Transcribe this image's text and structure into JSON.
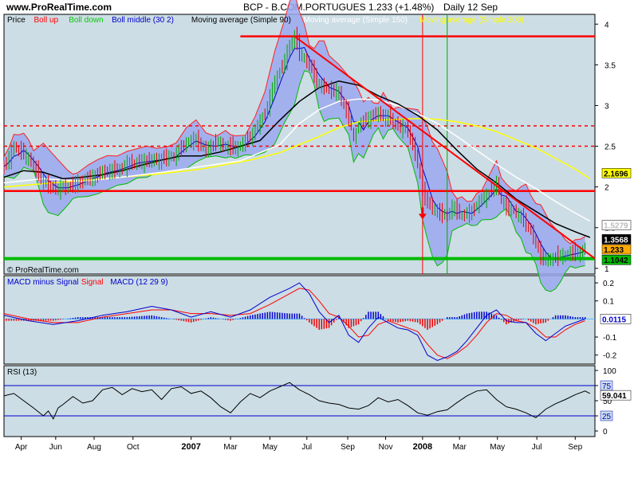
{
  "header": {
    "site": "www.ProRealTime.com",
    "instrument": "BCP - B.COM.PORTUGUES",
    "last_quote": "1.233 (+1.48%)",
    "period": "Daily 12 Sep"
  },
  "watermark": "© ProRealTime.com",
  "legends": {
    "price": [
      {
        "text": "Price",
        "color": "#000000"
      },
      {
        "text": "Boll up",
        "color": "#ff0000"
      },
      {
        "text": "Boll down",
        "color": "#00cc00"
      },
      {
        "text": "Boll middle (30 2)",
        "color": "#0000cc"
      },
      {
        "text": "Moving average (Simple 90)",
        "color": "#000000"
      },
      {
        "text": "Moving average (Simple 150)",
        "color": "#ffffff"
      },
      {
        "text": "Moving average (Simple 200)",
        "color": "#ffff00"
      }
    ],
    "macd": [
      {
        "text": "MACD minus Signal",
        "color": "#0000cc"
      },
      {
        "text": "Signal",
        "color": "#ff0000"
      },
      {
        "text": "MACD (12 29 9)",
        "color": "#0000cc"
      }
    ],
    "rsi": [
      {
        "text": "RSI (13)",
        "color": "#000000"
      }
    ]
  },
  "colors": {
    "panel_bg": "#ccdde5",
    "page_bg": "#ffffff",
    "band_fill": "#9aa8ee",
    "boll_up": "#ff2020",
    "boll_down": "#00bb00",
    "boll_mid": "#0000cc",
    "ma90": "#000000",
    "ma150": "#ffffff",
    "ma200": "#ffff00",
    "trend": "#ff0000",
    "support": "#00bb00",
    "resistance": "#ff0000",
    "candle_up": "#00aa00",
    "candle_down": "#ee0000"
  },
  "time_axis": {
    "labels": [
      "Apr",
      "Jun",
      "Aug",
      "Oct",
      "2007",
      "Mar",
      "May",
      "Jul",
      "Sep",
      "Nov",
      "2008",
      "Mar",
      "May",
      "Jul",
      "Sep"
    ],
    "bold_labels": [
      "2007",
      "2008"
    ]
  },
  "chart_data": [
    {
      "type": "line",
      "panel": "price",
      "ylim": [
        0.93,
        4.12
      ],
      "y_ticks": [
        1,
        1.5,
        2,
        2.5,
        3,
        3.5,
        4
      ],
      "y_tick_labels": [
        "1",
        "1.5",
        "2",
        "2.5",
        "3",
        "3.5",
        "4"
      ],
      "x_labels": [
        "Apr",
        "Jun",
        "Aug",
        "Oct",
        "2007",
        "Mar",
        "May",
        "Jul",
        "Sep",
        "Nov",
        "2008",
        "Mar",
        "May",
        "Jul",
        "Sep"
      ],
      "x_range": [
        0,
        120
      ],
      "grid": false,
      "legend_position": "top",
      "price_points": [
        [
          0,
          2.25
        ],
        [
          1,
          2.35
        ],
        [
          2,
          2.5
        ],
        [
          3,
          2.45
        ],
        [
          5,
          2.35
        ],
        [
          7,
          2.15
        ],
        [
          9,
          2.0
        ],
        [
          11,
          1.98
        ],
        [
          13,
          2.0
        ],
        [
          15,
          2.05
        ],
        [
          17,
          2.1
        ],
        [
          19,
          2.15
        ],
        [
          21,
          2.2
        ],
        [
          23,
          2.2
        ],
        [
          25,
          2.28
        ],
        [
          27,
          2.3
        ],
        [
          29,
          2.32
        ],
        [
          31,
          2.33
        ],
        [
          33,
          2.35
        ],
        [
          35,
          2.4
        ],
        [
          37,
          2.55
        ],
        [
          39,
          2.58
        ],
        [
          41,
          2.45
        ],
        [
          43,
          2.55
        ],
        [
          45,
          2.5
        ],
        [
          47,
          2.48
        ],
        [
          49,
          2.55
        ],
        [
          51,
          2.7
        ],
        [
          53,
          2.9
        ],
        [
          55,
          3.3
        ],
        [
          57,
          3.55
        ],
        [
          58,
          3.75
        ],
        [
          59,
          3.85
        ],
        [
          60,
          3.65
        ],
        [
          62,
          3.5
        ],
        [
          64,
          3.25
        ],
        [
          66,
          3.2
        ],
        [
          68,
          3.15
        ],
        [
          70,
          2.85
        ],
        [
          71,
          2.6
        ],
        [
          72,
          2.75
        ],
        [
          74,
          2.85
        ],
        [
          76,
          2.9
        ],
        [
          78,
          2.85
        ],
        [
          80,
          2.75
        ],
        [
          82,
          2.7
        ],
        [
          83,
          2.5
        ],
        [
          84,
          2.3
        ],
        [
          85,
          1.95
        ],
        [
          86,
          1.8
        ],
        [
          87,
          1.75
        ],
        [
          88,
          1.7
        ],
        [
          89,
          1.65
        ],
        [
          90,
          1.65
        ],
        [
          91,
          1.75
        ],
        [
          92,
          1.7
        ],
        [
          93,
          1.65
        ],
        [
          95,
          1.7
        ],
        [
          97,
          1.85
        ],
        [
          99,
          1.95
        ],
        [
          100,
          2.05
        ],
        [
          101,
          1.85
        ],
        [
          102,
          1.72
        ],
        [
          103,
          1.75
        ],
        [
          104,
          1.68
        ],
        [
          105,
          1.62
        ],
        [
          106,
          1.55
        ],
        [
          107,
          1.45
        ],
        [
          108,
          1.3
        ],
        [
          109,
          1.15
        ],
        [
          110,
          1.1
        ],
        [
          111,
          1.12
        ],
        [
          113,
          1.15
        ],
        [
          115,
          1.18
        ],
        [
          117,
          1.2
        ],
        [
          118,
          1.233
        ]
      ],
      "moving_average_90": [
        [
          0,
          2.12
        ],
        [
          4,
          2.2
        ],
        [
          8,
          2.18
        ],
        [
          12,
          2.1
        ],
        [
          16,
          2.12
        ],
        [
          20,
          2.15
        ],
        [
          24,
          2.2
        ],
        [
          28,
          2.27
        ],
        [
          32,
          2.33
        ],
        [
          36,
          2.38
        ],
        [
          40,
          2.38
        ],
        [
          44,
          2.43
        ],
        [
          48,
          2.5
        ],
        [
          52,
          2.57
        ],
        [
          56,
          2.82
        ],
        [
          60,
          3.05
        ],
        [
          64,
          3.22
        ],
        [
          68,
          3.3
        ],
        [
          72,
          3.25
        ],
        [
          76,
          3.12
        ],
        [
          80,
          3.02
        ],
        [
          84,
          2.88
        ],
        [
          88,
          2.7
        ],
        [
          92,
          2.45
        ],
        [
          96,
          2.22
        ],
        [
          100,
          2.05
        ],
        [
          104,
          1.85
        ],
        [
          108,
          1.7
        ],
        [
          112,
          1.55
        ],
        [
          116,
          1.45
        ],
        [
          119,
          1.38
        ]
      ],
      "moving_average_150": [
        [
          0,
          2.05
        ],
        [
          8,
          2.1
        ],
        [
          16,
          2.07
        ],
        [
          24,
          2.12
        ],
        [
          32,
          2.18
        ],
        [
          40,
          2.25
        ],
        [
          48,
          2.32
        ],
        [
          56,
          2.52
        ],
        [
          60,
          2.78
        ],
        [
          64,
          2.95
        ],
        [
          68,
          3.05
        ],
        [
          72,
          3.08
        ],
        [
          76,
          3.07
        ],
        [
          80,
          3.0
        ],
        [
          84,
          2.9
        ],
        [
          88,
          2.78
        ],
        [
          92,
          2.62
        ],
        [
          96,
          2.45
        ],
        [
          100,
          2.28
        ],
        [
          104,
          2.12
        ],
        [
          108,
          1.98
        ],
        [
          112,
          1.82
        ],
        [
          116,
          1.68
        ],
        [
          119,
          1.58
        ]
      ],
      "moving_average_200": [
        [
          0,
          2.0
        ],
        [
          10,
          2.05
        ],
        [
          20,
          2.1
        ],
        [
          30,
          2.15
        ],
        [
          40,
          2.22
        ],
        [
          50,
          2.33
        ],
        [
          56,
          2.42
        ],
        [
          60,
          2.52
        ],
        [
          64,
          2.62
        ],
        [
          68,
          2.73
        ],
        [
          72,
          2.8
        ],
        [
          76,
          2.82
        ],
        [
          80,
          2.83
        ],
        [
          84,
          2.84
        ],
        [
          88,
          2.83
        ],
        [
          92,
          2.8
        ],
        [
          96,
          2.75
        ],
        [
          100,
          2.68
        ],
        [
          104,
          2.58
        ],
        [
          108,
          2.48
        ],
        [
          112,
          2.35
        ],
        [
          116,
          2.22
        ],
        [
          119,
          2.1
        ]
      ],
      "horizontal_lines": [
        {
          "value": 3.85,
          "style": "solid",
          "color": "#ff0000"
        },
        {
          "value": 2.75,
          "style": "dashed",
          "color": "#ff0000"
        },
        {
          "value": 2.5,
          "style": "dashed",
          "color": "#ff0000"
        },
        {
          "value": 1.95,
          "style": "solid",
          "color": "#ff0000"
        },
        {
          "value": 1.12,
          "style": "solid",
          "color": "#00bb00"
        }
      ],
      "trendline": {
        "from": [
          59,
          3.85
        ],
        "to": [
          120,
          1.12
        ]
      },
      "value_labels": [
        {
          "text": "2.1696",
          "bg": "#ffff00",
          "value": 2.17
        },
        {
          "text": "1.5279",
          "bg": "#ffffff",
          "value": 1.53
        },
        {
          "text": "1.3568",
          "bg": "#000000",
          "value": 1.357
        },
        {
          "text": "1.233",
          "bg": "#ffaa00",
          "value": 1.233
        },
        {
          "text": "1.1042",
          "bg": "#00bb00",
          "value": 1.104
        }
      ]
    },
    {
      "type": "bar",
      "panel": "macd",
      "ylim": [
        -0.25,
        0.24
      ],
      "y_ticks": [
        0.2,
        0.1,
        -0.1,
        -0.2
      ],
      "y_tick_labels": [
        "0.2",
        "0.1",
        "-0.1",
        "-0.2"
      ],
      "macd_series": [
        [
          0,
          0.02
        ],
        [
          5,
          -0.01
        ],
        [
          10,
          -0.03
        ],
        [
          15,
          -0.01
        ],
        [
          20,
          0.02
        ],
        [
          25,
          0.04
        ],
        [
          30,
          0.07
        ],
        [
          34,
          0.05
        ],
        [
          38,
          0.01
        ],
        [
          42,
          0.04
        ],
        [
          46,
          0.01
        ],
        [
          50,
          0.05
        ],
        [
          54,
          0.12
        ],
        [
          58,
          0.17
        ],
        [
          60,
          0.2
        ],
        [
          62,
          0.14
        ],
        [
          64,
          0.04
        ],
        [
          66,
          -0.02
        ],
        [
          68,
          0.02
        ],
        [
          70,
          -0.09
        ],
        [
          72,
          -0.13
        ],
        [
          74,
          -0.05
        ],
        [
          76,
          0.01
        ],
        [
          78,
          -0.02
        ],
        [
          80,
          -0.05
        ],
        [
          82,
          -0.06
        ],
        [
          84,
          -0.09
        ],
        [
          86,
          -0.2
        ],
        [
          88,
          -0.23
        ],
        [
          90,
          -0.21
        ],
        [
          92,
          -0.18
        ],
        [
          94,
          -0.12
        ],
        [
          96,
          -0.05
        ],
        [
          98,
          0.02
        ],
        [
          100,
          0.05
        ],
        [
          102,
          -0.01
        ],
        [
          104,
          -0.02
        ],
        [
          106,
          -0.02
        ],
        [
          108,
          -0.08
        ],
        [
          110,
          -0.12
        ],
        [
          112,
          -0.08
        ],
        [
          114,
          -0.04
        ],
        [
          116,
          -0.02
        ],
        [
          118,
          0.0
        ]
      ],
      "signal_series": [
        [
          0,
          0.03
        ],
        [
          5,
          0.0
        ],
        [
          10,
          -0.02
        ],
        [
          15,
          -0.02
        ],
        [
          20,
          0.01
        ],
        [
          25,
          0.03
        ],
        [
          30,
          0.05
        ],
        [
          34,
          0.05
        ],
        [
          38,
          0.03
        ],
        [
          42,
          0.03
        ],
        [
          46,
          0.02
        ],
        [
          50,
          0.03
        ],
        [
          54,
          0.08
        ],
        [
          58,
          0.14
        ],
        [
          60,
          0.17
        ],
        [
          62,
          0.16
        ],
        [
          64,
          0.1
        ],
        [
          66,
          0.03
        ],
        [
          68,
          0.01
        ],
        [
          70,
          -0.04
        ],
        [
          72,
          -0.1
        ],
        [
          74,
          -0.09
        ],
        [
          76,
          -0.03
        ],
        [
          78,
          -0.01
        ],
        [
          80,
          -0.03
        ],
        [
          82,
          -0.05
        ],
        [
          84,
          -0.07
        ],
        [
          86,
          -0.14
        ],
        [
          88,
          -0.2
        ],
        [
          90,
          -0.22
        ],
        [
          92,
          -0.19
        ],
        [
          94,
          -0.15
        ],
        [
          96,
          -0.09
        ],
        [
          98,
          -0.02
        ],
        [
          100,
          0.03
        ],
        [
          102,
          0.02
        ],
        [
          104,
          -0.01
        ],
        [
          106,
          -0.02
        ],
        [
          108,
          -0.05
        ],
        [
          110,
          -0.1
        ],
        [
          112,
          -0.1
        ],
        [
          114,
          -0.06
        ],
        [
          116,
          -0.03
        ],
        [
          118,
          -0.01
        ]
      ],
      "current_value": "0.0115"
    },
    {
      "type": "line",
      "panel": "rsi",
      "ylim": [
        0,
        100
      ],
      "y_ticks": [
        100,
        75,
        50,
        25,
        0
      ],
      "y_tick_labels": [
        "100",
        "75",
        "50",
        "25",
        "0"
      ],
      "levels": [
        75,
        25
      ],
      "level_labels": [
        "75",
        "25"
      ],
      "rsi_series": [
        [
          0,
          58
        ],
        [
          2,
          62
        ],
        [
          4,
          50
        ],
        [
          6,
          38
        ],
        [
          8,
          25
        ],
        [
          9,
          33
        ],
        [
          10,
          20
        ],
        [
          11,
          38
        ],
        [
          12,
          44
        ],
        [
          14,
          57
        ],
        [
          16,
          46
        ],
        [
          18,
          50
        ],
        [
          20,
          68
        ],
        [
          22,
          72
        ],
        [
          24,
          60
        ],
        [
          26,
          70
        ],
        [
          28,
          65
        ],
        [
          30,
          68
        ],
        [
          32,
          52
        ],
        [
          34,
          70
        ],
        [
          36,
          73
        ],
        [
          38,
          62
        ],
        [
          40,
          66
        ],
        [
          42,
          55
        ],
        [
          44,
          40
        ],
        [
          46,
          30
        ],
        [
          48,
          48
        ],
        [
          50,
          62
        ],
        [
          52,
          55
        ],
        [
          54,
          66
        ],
        [
          56,
          73
        ],
        [
          58,
          80
        ],
        [
          60,
          68
        ],
        [
          62,
          60
        ],
        [
          64,
          50
        ],
        [
          66,
          46
        ],
        [
          68,
          44
        ],
        [
          70,
          38
        ],
        [
          72,
          36
        ],
        [
          74,
          42
        ],
        [
          76,
          55
        ],
        [
          78,
          48
        ],
        [
          80,
          52
        ],
        [
          82,
          42
        ],
        [
          84,
          30
        ],
        [
          86,
          26
        ],
        [
          88,
          32
        ],
        [
          90,
          35
        ],
        [
          92,
          47
        ],
        [
          94,
          58
        ],
        [
          96,
          66
        ],
        [
          98,
          68
        ],
        [
          100,
          52
        ],
        [
          102,
          40
        ],
        [
          104,
          36
        ],
        [
          106,
          30
        ],
        [
          108,
          22
        ],
        [
          110,
          36
        ],
        [
          112,
          45
        ],
        [
          114,
          52
        ],
        [
          116,
          60
        ],
        [
          118,
          66
        ],
        [
          119,
          62
        ]
      ],
      "current_value": "59.041"
    }
  ]
}
